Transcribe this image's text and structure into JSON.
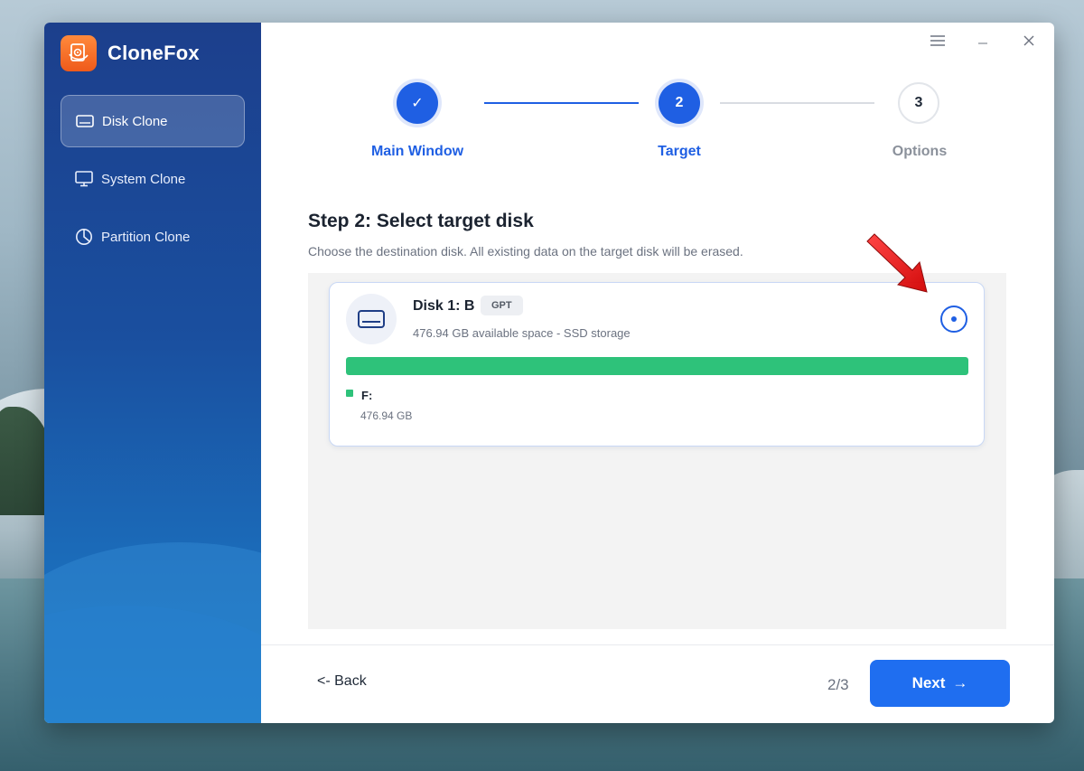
{
  "app": {
    "title": "CloneFox"
  },
  "sidebar": {
    "items": [
      {
        "label": "Disk Clone",
        "icon": "disk-icon",
        "active": true
      },
      {
        "label": "System Clone",
        "icon": "monitor-icon",
        "active": false
      },
      {
        "label": "Partition Clone",
        "icon": "pie-chart-icon",
        "active": false
      }
    ]
  },
  "titlebar": {
    "menu_icon": "hamburger-icon",
    "minimize_icon": "minimize-icon",
    "close_icon": "close-icon"
  },
  "steps": [
    {
      "number": "✓",
      "label": "Main Window",
      "state": "done"
    },
    {
      "number": "2",
      "label": "Target",
      "state": "active"
    },
    {
      "number": "3",
      "label": "Options",
      "state": "pending"
    }
  ],
  "main": {
    "title": "Step 2: Select target disk",
    "description": "Choose the destination disk. All existing data on the target disk will be erased."
  },
  "disk": {
    "name": "Disk 1: B",
    "badge": "GPT",
    "info": "476.94 GB available space - SSD storage",
    "selected": true,
    "usage_fraction": 1.0,
    "partition_label": "F:",
    "partition_size": "476.94 GB",
    "bar_color": "#2ec27a"
  },
  "footer": {
    "back_label": "<- Back",
    "page_indicator": "2/3",
    "next_label": "Next",
    "next_arrow": "→"
  },
  "colors": {
    "accent": "#1f5fe3",
    "sidebar_top": "#1c3f8c",
    "sidebar_bottom": "#1a7cc6",
    "brand": "#ef5a1a"
  }
}
